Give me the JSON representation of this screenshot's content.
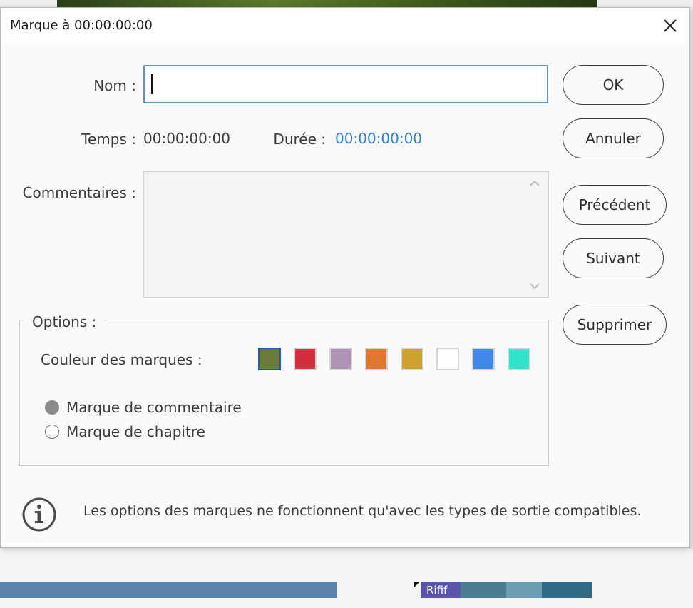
{
  "dialog": {
    "title": "Marque à 00:00:00:00"
  },
  "form": {
    "name_label": "Nom :",
    "name_value": "",
    "time_label": "Temps :",
    "time_value": "00:00:00:00",
    "duration_label": "Durée :",
    "duration_value": "00:00:00:00",
    "comments_label": "Commentaires :",
    "comments_value": ""
  },
  "buttons": {
    "ok": "OK",
    "cancel": "Annuler",
    "previous": "Précédent",
    "next": "Suivant",
    "delete": "Supprimer"
  },
  "options": {
    "legend": "Options :",
    "color_label": "Couleur des marques :",
    "colors": [
      "#6b7a3a",
      "#d22e3c",
      "#b094b6",
      "#e3762e",
      "#cfa22f",
      "#ffffff",
      "#4189e8",
      "#31e3c9"
    ],
    "selected_color": "#6b7a3a",
    "marker_types": [
      {
        "label": "Marque de commentaire",
        "selected": true
      },
      {
        "label": "Marque de chapitre",
        "selected": false
      }
    ]
  },
  "info": {
    "text": "Les options des marques ne fonctionnent qu'avec les types de sortie compatibles."
  },
  "background": {
    "clip_label": "Rifif"
  },
  "icons": {
    "close": "close-icon",
    "info": "info-icon",
    "scroll_up": "chevron-up-icon",
    "scroll_down": "chevron-down-icon"
  }
}
